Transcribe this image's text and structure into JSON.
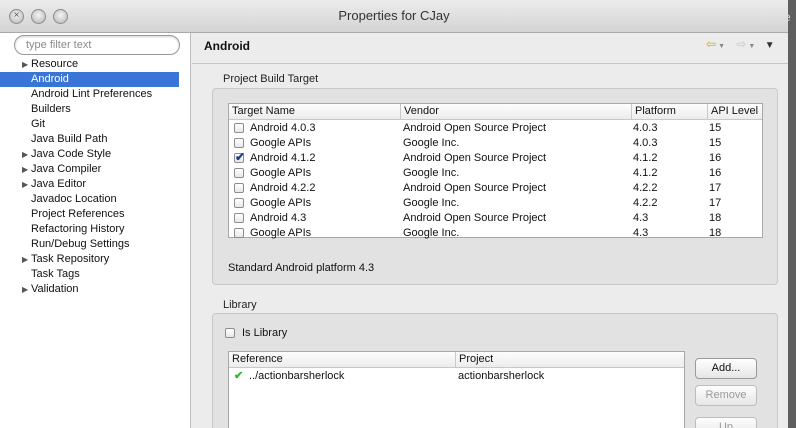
{
  "window": {
    "title": "Properties for CJay"
  },
  "sidebar": {
    "filter_placeholder": "type filter text",
    "items": [
      {
        "label": "Resource",
        "expandable": true
      },
      {
        "label": "Android",
        "expandable": false,
        "selected": true
      },
      {
        "label": "Android Lint Preferences",
        "expandable": false
      },
      {
        "label": "Builders",
        "expandable": false
      },
      {
        "label": "Git",
        "expandable": false
      },
      {
        "label": "Java Build Path",
        "expandable": false
      },
      {
        "label": "Java Code Style",
        "expandable": true
      },
      {
        "label": "Java Compiler",
        "expandable": true
      },
      {
        "label": "Java Editor",
        "expandable": true
      },
      {
        "label": "Javadoc Location",
        "expandable": false
      },
      {
        "label": "Project References",
        "expandable": false
      },
      {
        "label": "Refactoring History",
        "expandable": false
      },
      {
        "label": "Run/Debug Settings",
        "expandable": false
      },
      {
        "label": "Task Repository",
        "expandable": true
      },
      {
        "label": "Task Tags",
        "expandable": false
      },
      {
        "label": "Validation",
        "expandable": true
      }
    ]
  },
  "main": {
    "title": "Android",
    "build_target": {
      "group_label": "Project Build Target",
      "columns": [
        "Target Name",
        "Vendor",
        "Platform",
        "API Level"
      ],
      "rows": [
        {
          "name": "Android 4.0.3",
          "vendor": "Android Open Source Project",
          "platform": "4.0.3",
          "api": "15",
          "checked": false
        },
        {
          "name": "Google APIs",
          "vendor": "Google Inc.",
          "platform": "4.0.3",
          "api": "15",
          "checked": false
        },
        {
          "name": "Android 4.1.2",
          "vendor": "Android Open Source Project",
          "platform": "4.1.2",
          "api": "16",
          "checked": true
        },
        {
          "name": "Google APIs",
          "vendor": "Google Inc.",
          "platform": "4.1.2",
          "api": "16",
          "checked": false
        },
        {
          "name": "Android 4.2.2",
          "vendor": "Android Open Source Project",
          "platform": "4.2.2",
          "api": "17",
          "checked": false
        },
        {
          "name": "Google APIs",
          "vendor": "Google Inc.",
          "platform": "4.2.2",
          "api": "17",
          "checked": false
        },
        {
          "name": "Android 4.3",
          "vendor": "Android Open Source Project",
          "platform": "4.3",
          "api": "18",
          "checked": false
        },
        {
          "name": "Google APIs",
          "vendor": "Google Inc.",
          "platform": "4.3",
          "api": "18",
          "checked": false
        }
      ],
      "status": "Standard Android platform 4.3"
    },
    "library": {
      "group_label": "Library",
      "is_library_label": "Is Library",
      "is_library_checked": false,
      "columns": [
        "Reference",
        "Project"
      ],
      "rows": [
        {
          "reference": "../actionbarsherlock",
          "project": "actionbarsherlock",
          "ok": true
        }
      ],
      "buttons": {
        "add": "Add...",
        "remove": "Remove",
        "up": "Up"
      }
    }
  },
  "colors": {
    "selection": "#3875d7",
    "nav_arrow": "#d49a1e",
    "check_ok": "#2fb52f"
  }
}
